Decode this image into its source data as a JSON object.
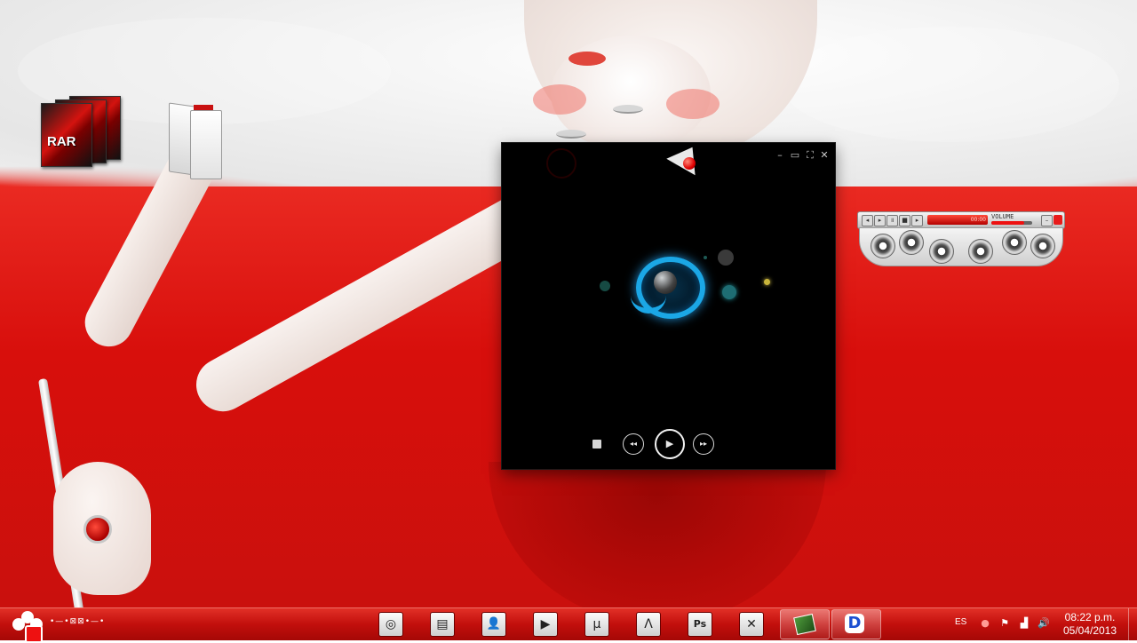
{
  "desktop": {
    "icons": [
      {
        "name": "RAR",
        "icon": "winrar-archive-icon"
      },
      {
        "name": "",
        "icon": "documents-folder-icon"
      }
    ]
  },
  "player": {
    "window_controls": {
      "minimize": "–",
      "restore": "▭",
      "fullscreen": "⛶",
      "close": "✕"
    },
    "logo_icon": "qq-player-logo-icon",
    "transport": {
      "stop": "stop-icon",
      "rewind": "◂◂",
      "play": "▶",
      "forward": "▸▸"
    }
  },
  "volume_gadget": {
    "display_text": "00:00",
    "volume_label": "VOLUME",
    "volume_level": 0.8,
    "speaker_count": 6
  },
  "taskbar": {
    "tray_label": "•—•⊠⊠•—•",
    "pinned": [
      {
        "name": "chrome",
        "glyph": "◎"
      },
      {
        "name": "explorer",
        "glyph": "▤"
      },
      {
        "name": "user",
        "glyph": "👤"
      },
      {
        "name": "media",
        "glyph": "▶"
      },
      {
        "name": "utorrent",
        "glyph": "µ"
      },
      {
        "name": "acrobat",
        "glyph": "Λ"
      },
      {
        "name": "photoshop",
        "glyph": "Ps"
      },
      {
        "name": "close-app",
        "glyph": "✕"
      }
    ],
    "language": "ES",
    "time": "08:22 p.m.",
    "date": "05/04/2013"
  },
  "colors": {
    "accent": "#d80f0c",
    "player_bg": "#000000",
    "logo_blue": "#1ba7e6"
  }
}
